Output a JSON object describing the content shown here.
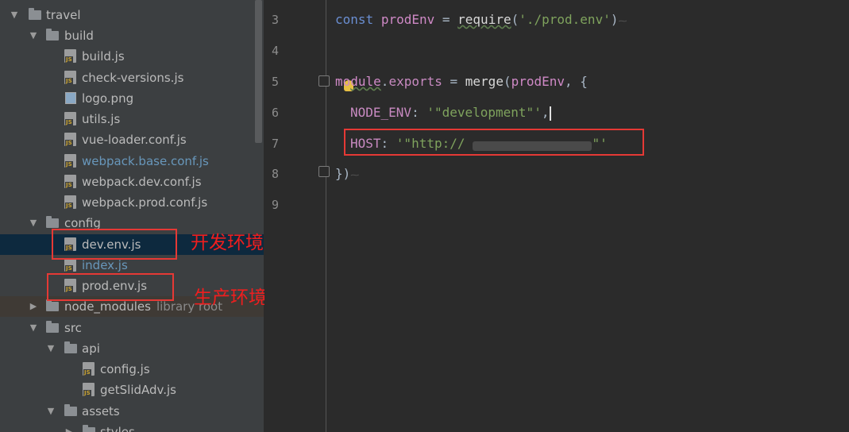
{
  "tree": {
    "items": [
      {
        "label": "travel"
      },
      {
        "label": "build"
      },
      {
        "label": "build.js"
      },
      {
        "label": "check-versions.js"
      },
      {
        "label": "logo.png"
      },
      {
        "label": "utils.js"
      },
      {
        "label": "vue-loader.conf.js"
      },
      {
        "label": "webpack.base.conf.js"
      },
      {
        "label": "webpack.dev.conf.js"
      },
      {
        "label": "webpack.prod.conf.js"
      },
      {
        "label": "config"
      },
      {
        "label": "dev.env.js"
      },
      {
        "label": "index.js"
      },
      {
        "label": "prod.env.js"
      },
      {
        "label": "node_modules",
        "suffix": "library root"
      },
      {
        "label": "src"
      },
      {
        "label": "api"
      },
      {
        "label": "config.js"
      },
      {
        "label": "getSlidAdv.js"
      },
      {
        "label": "assets"
      },
      {
        "label": "styles"
      }
    ]
  },
  "annotations": {
    "dev": "开发环境",
    "prod": "生产环境"
  },
  "editor": {
    "line_numbers": [
      "3",
      "4",
      "5",
      "6",
      "7",
      "8",
      "9"
    ],
    "line3": {
      "kw": "const",
      "var": "prodEnv",
      "eq": " = ",
      "fn": "require",
      "open": "(",
      "str": "'./prod.env'",
      "close": ")"
    },
    "line5": {
      "a": "mo",
      "b": "dule",
      "dot": ".",
      "prop": "exports",
      "eq": " = ",
      "fn": "merge",
      "open": "(",
      "var": "prodEnv",
      "rest": ", {"
    },
    "line6": {
      "key": "NODE_ENV",
      "colon": ": ",
      "str": "'\"development\"'",
      "comma": ","
    },
    "line7": {
      "key": "HOST",
      "colon": ": ",
      "str_start": "'\"http://",
      "str_end": "\"'"
    },
    "line8": {
      "text": "})"
    }
  },
  "colors": {
    "highlight": "#e53935",
    "annotation": "#f01e1e",
    "selected_row": "#0d293e"
  }
}
